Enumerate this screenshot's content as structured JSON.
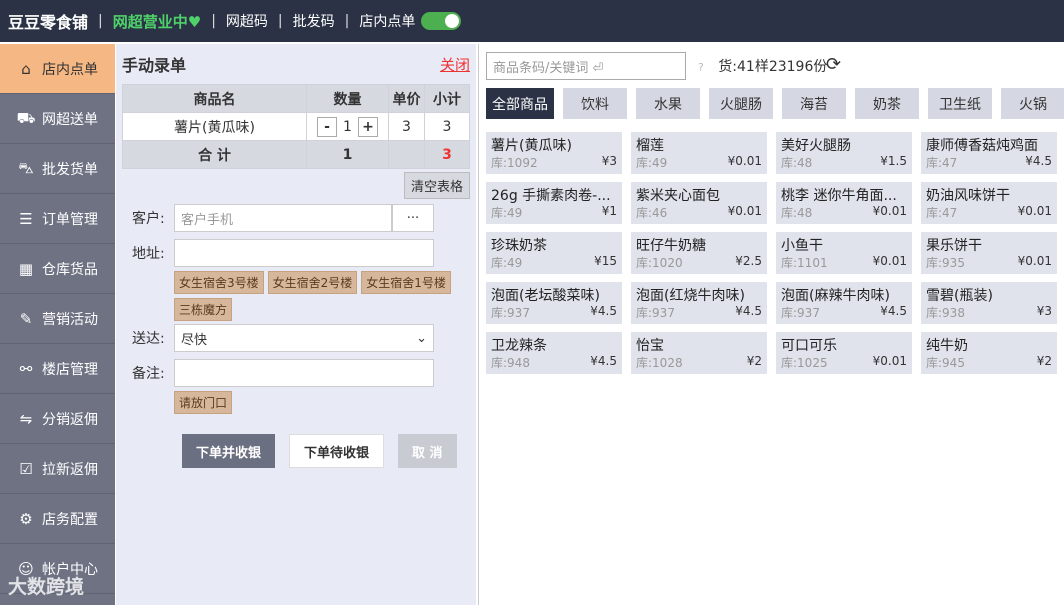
{
  "topbar": {
    "shop_name": "豆豆零食铺",
    "status": "网超营业中♥",
    "links": [
      "网超码",
      "批发码",
      "店内点单"
    ]
  },
  "sidebar": {
    "items": [
      {
        "label": "店内点单",
        "icon": "home-icon",
        "glyph": "⌂"
      },
      {
        "label": "网超送单",
        "icon": "delivery-icon",
        "glyph": "⛟"
      },
      {
        "label": "批发货单",
        "icon": "truck-icon",
        "glyph": "⛍"
      },
      {
        "label": "订单管理",
        "icon": "order-icon",
        "glyph": "☰"
      },
      {
        "label": "仓库货品",
        "icon": "warehouse-icon",
        "glyph": "▦"
      },
      {
        "label": "营销活动",
        "icon": "tag-icon",
        "glyph": "✎"
      },
      {
        "label": "楼店管理",
        "icon": "network-icon",
        "glyph": "⚯"
      },
      {
        "label": "分销返佣",
        "icon": "share-icon",
        "glyph": "⇋"
      },
      {
        "label": "拉新返佣",
        "icon": "check-icon",
        "glyph": "☑"
      },
      {
        "label": "店务配置",
        "icon": "settings-icon",
        "glyph": "⚙"
      },
      {
        "label": "帐户中心",
        "icon": "user-icon",
        "glyph": "☺"
      }
    ]
  },
  "panel": {
    "title": "手动录单",
    "close_label": "关闭",
    "headers": [
      "商品名",
      "数量",
      "单价",
      "小计"
    ],
    "rows": [
      {
        "name": "薯片(黄瓜味)",
        "qty": "1",
        "price": "3",
        "subtotal": "3"
      }
    ],
    "total_label": "合 计",
    "total_qty": "1",
    "total_amount": "3",
    "minus": "-",
    "plus": "+",
    "clear_label": "清空表格",
    "customer_label": "客户:",
    "customer_placeholder": "客户手机",
    "more_label": "···",
    "address_label": "地址:",
    "address_tags": [
      "女生宿舍3号楼",
      "女生宿舍2号楼",
      "女生宿舍1号楼",
      "三栋魔方"
    ],
    "delivery_label": "送达:",
    "delivery_value": "尽快",
    "note_label": "备注:",
    "note_tags": [
      "请放门口"
    ],
    "btn_order_collect": "下单并收银",
    "btn_order_wait": "下单待收银",
    "btn_cancel": "取 消"
  },
  "right": {
    "search_placeholder": "商品条码/关键词 ⏎",
    "help_mark": "?",
    "stock_info": "货:41样23196份",
    "categories": [
      "全部商品",
      "饮料",
      "水果",
      "火腿肠",
      "海苔",
      "奶茶",
      "卫生纸",
      "火锅"
    ],
    "products": [
      {
        "name": "薯片(黄瓜味)",
        "stock": "库:1092",
        "price": "¥3"
      },
      {
        "name": "榴莲",
        "stock": "库:49",
        "price": "¥0.01"
      },
      {
        "name": "美好火腿肠",
        "stock": "库:48",
        "price": "¥1.5"
      },
      {
        "name": "康师傅香菇炖鸡面",
        "stock": "库:47",
        "price": "¥4.5"
      },
      {
        "name": "26g 手撕素肉卷-...",
        "stock": "库:49",
        "price": "¥1"
      },
      {
        "name": "紫米夹心面包",
        "stock": "库:46",
        "price": "¥0.01"
      },
      {
        "name": "桃李 迷你牛角面...",
        "stock": "库:48",
        "price": "¥0.01"
      },
      {
        "name": "奶油风味饼干",
        "stock": "库:47",
        "price": "¥0.01"
      },
      {
        "name": "珍珠奶茶",
        "stock": "库:49",
        "price": "¥15"
      },
      {
        "name": "旺仔牛奶糖",
        "stock": "库:1020",
        "price": "¥2.5"
      },
      {
        "name": "小鱼干",
        "stock": "库:1101",
        "price": "¥0.01"
      },
      {
        "name": "果乐饼干",
        "stock": "库:935",
        "price": "¥0.01"
      },
      {
        "name": "泡面(老坛酸菜味)",
        "stock": "库:937",
        "price": "¥4.5"
      },
      {
        "name": "泡面(红烧牛肉味)",
        "stock": "库:937",
        "price": "¥4.5"
      },
      {
        "name": "泡面(麻辣牛肉味)",
        "stock": "库:937",
        "price": "¥4.5"
      },
      {
        "name": "雪碧(瓶装)",
        "stock": "库:938",
        "price": "¥3"
      },
      {
        "name": "卫龙辣条",
        "stock": "库:948",
        "price": "¥4.5"
      },
      {
        "name": "怡宝",
        "stock": "库:1028",
        "price": "¥2"
      },
      {
        "name": "可口可乐",
        "stock": "库:1025",
        "price": "¥0.01"
      },
      {
        "name": "纯牛奶",
        "stock": "库:945",
        "price": "¥2"
      }
    ]
  },
  "watermark": "大数跨境"
}
